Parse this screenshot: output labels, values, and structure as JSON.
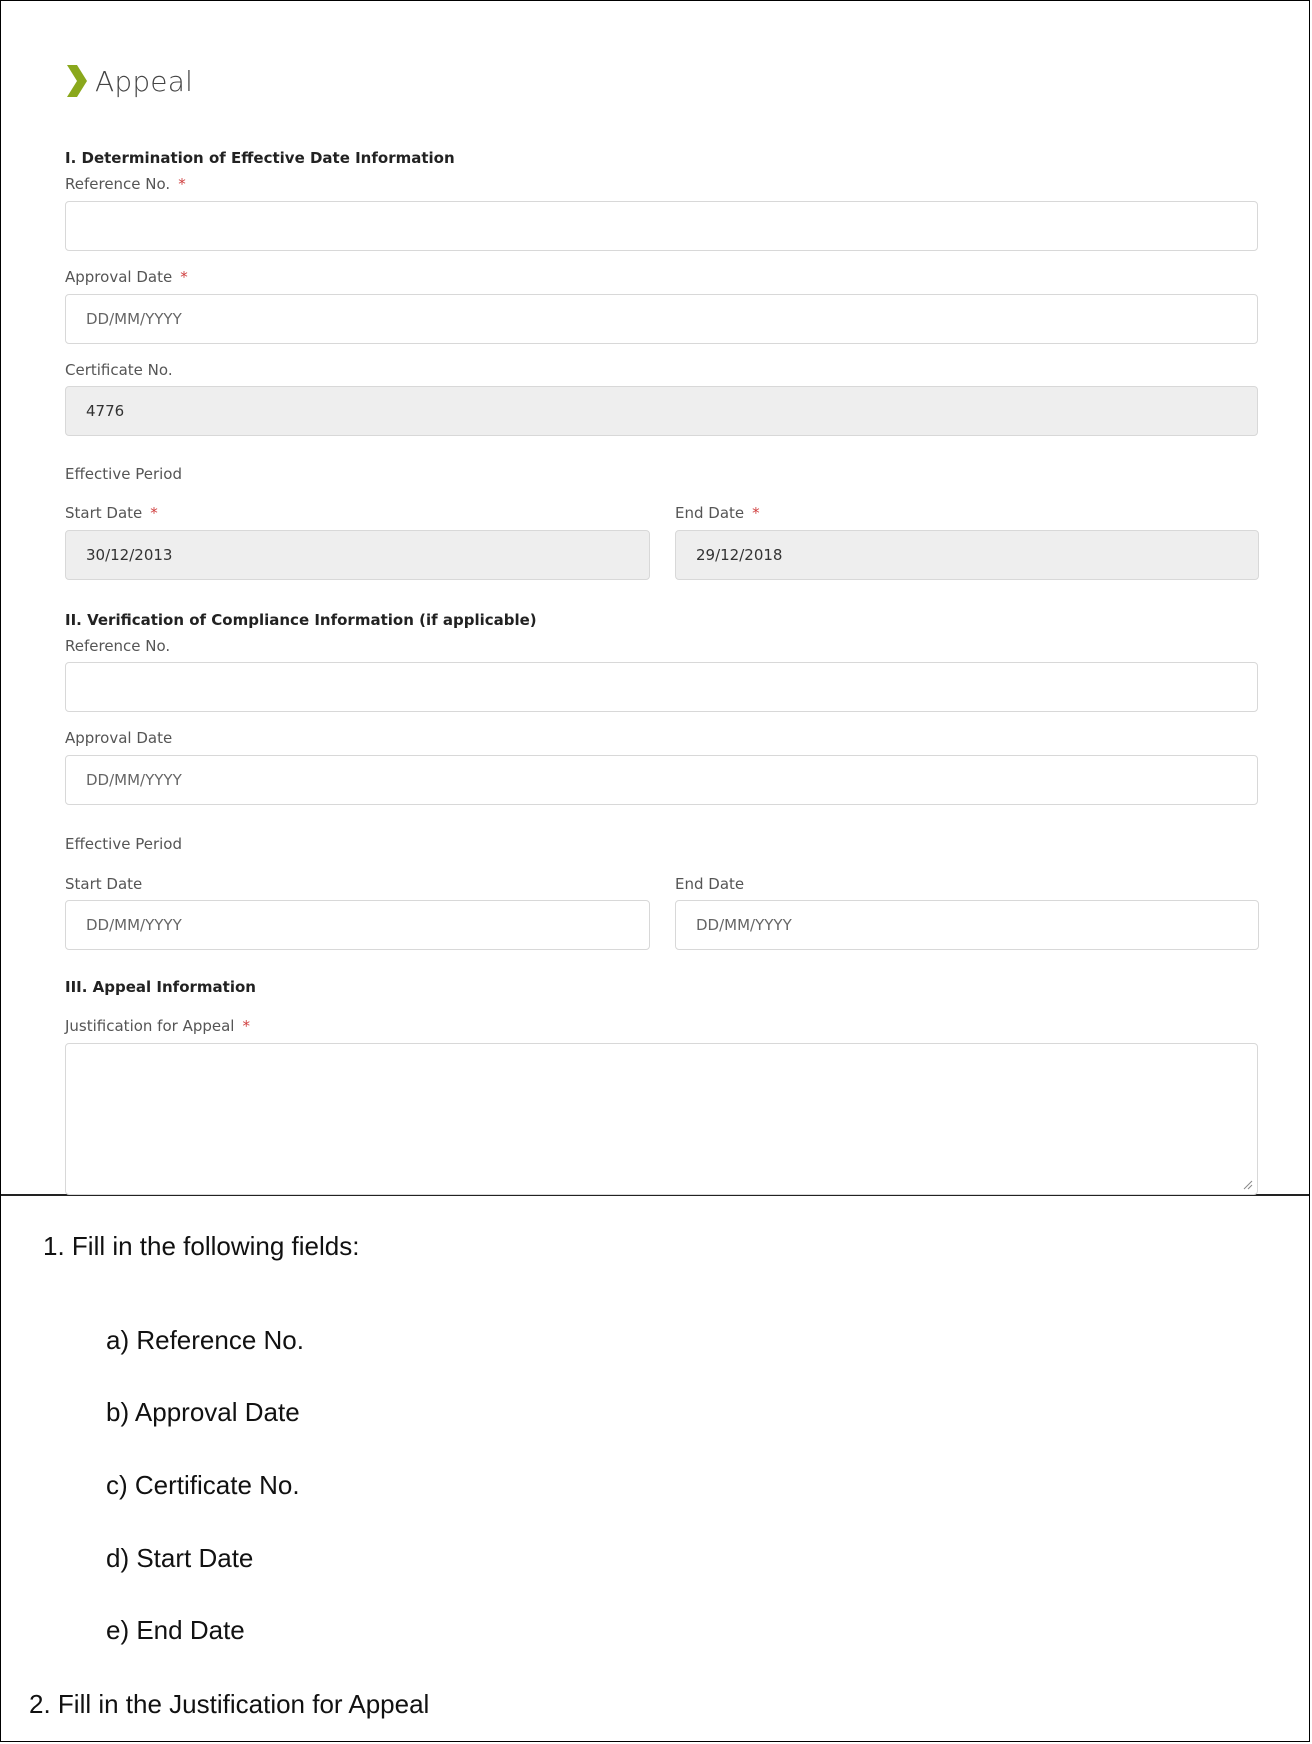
{
  "page": {
    "title": "Appeal"
  },
  "section1": {
    "heading": "I. Determination of Effective Date Information",
    "reference_label": "Reference No.",
    "reference_value": "",
    "approval_label": "Approval Date",
    "approval_placeholder": "DD/MM/YYYY",
    "certificate_label": "Certificate No.",
    "certificate_value": "4776",
    "effective_period_label": "Effective Period",
    "start_label": "Start Date",
    "start_value": "30/12/2013",
    "end_label": "End Date",
    "end_value": "29/12/2018",
    "required_mark": "*"
  },
  "section2": {
    "heading": "II. Verification of Compliance Information (if applicable)",
    "reference_label": "Reference No.",
    "reference_value": "",
    "approval_label": "Approval Date",
    "approval_placeholder": "DD/MM/YYYY",
    "effective_period_label": "Effective Period",
    "start_label": "Start Date",
    "start_placeholder": "DD/MM/YYYY",
    "end_label": "End Date",
    "end_placeholder": "DD/MM/YYYY"
  },
  "section3": {
    "heading": "III. Appeal Information",
    "justification_label": "Justification for Appeal",
    "required_mark": "*"
  },
  "instructions": {
    "step1": "1.  Fill in the following fields:",
    "items": [
      "a)  Reference No.",
      "b)  Approval Date",
      "c)  Certificate No.",
      "d)  Start Date",
      "e)  End Date"
    ],
    "step2": "2.  Fill in the Justification for Appeal"
  },
  "colors": {
    "accent": "#8aa81c",
    "required": "#d04040",
    "disabled_bg": "#eeeeee"
  },
  "icons": {
    "title": "chevron-right-icon"
  }
}
